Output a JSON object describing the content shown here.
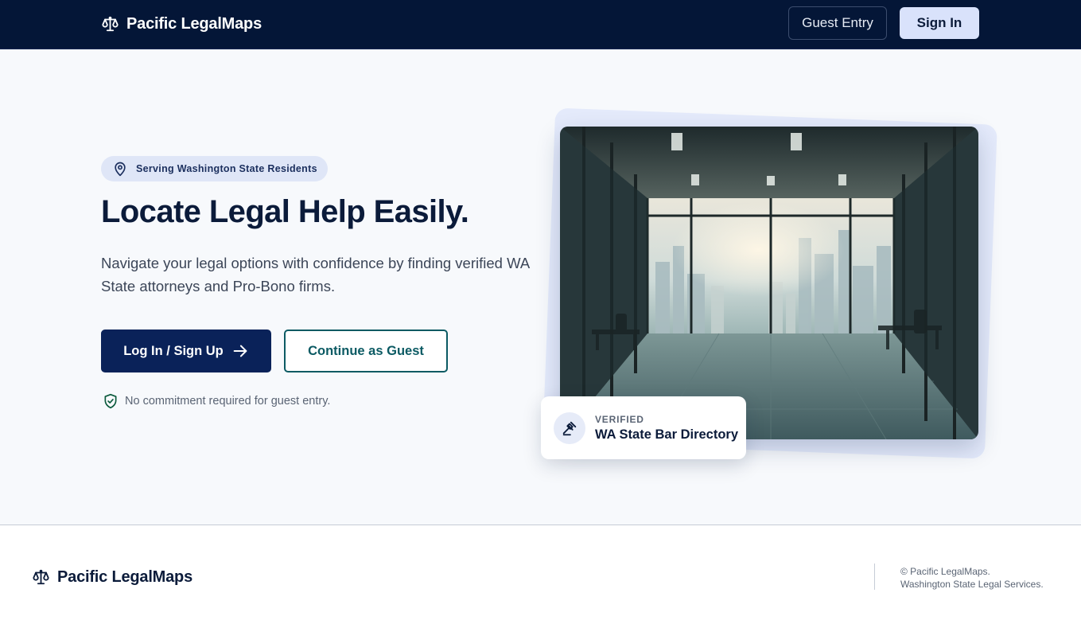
{
  "header": {
    "brand": "Pacific LegalMaps",
    "guest_entry_label": "Guest Entry",
    "sign_in_label": "Sign In"
  },
  "hero": {
    "badge": "Serving Washington State Residents",
    "headline": "Locate Legal Help Easily.",
    "subtext": "Navigate your legal options with confidence by finding verified WA State attorneys and Pro-Bono firms.",
    "login_label": "Log In / Sign Up",
    "guest_label": "Continue as Guest",
    "note": "No commitment required for guest entry."
  },
  "verified_card": {
    "kicker": "VERIFIED",
    "title": "WA State Bar Directory"
  },
  "footer": {
    "brand": "Pacific LegalMaps",
    "copyright_line1": "© Pacific LegalMaps.",
    "copyright_line2": "Washington State Legal Services."
  },
  "icons": {
    "brand": "scale-icon",
    "badge": "map-pin-icon",
    "login_arrow": "arrow-right-icon",
    "note": "shield-check-icon",
    "verified": "gavel-icon"
  },
  "colors": {
    "header_bg": "#041637",
    "primary": "#0a2259",
    "accent_teal": "#0b5a63",
    "sign_in_bg": "#d9e2fb",
    "page_bg": "#f7f9fc"
  }
}
